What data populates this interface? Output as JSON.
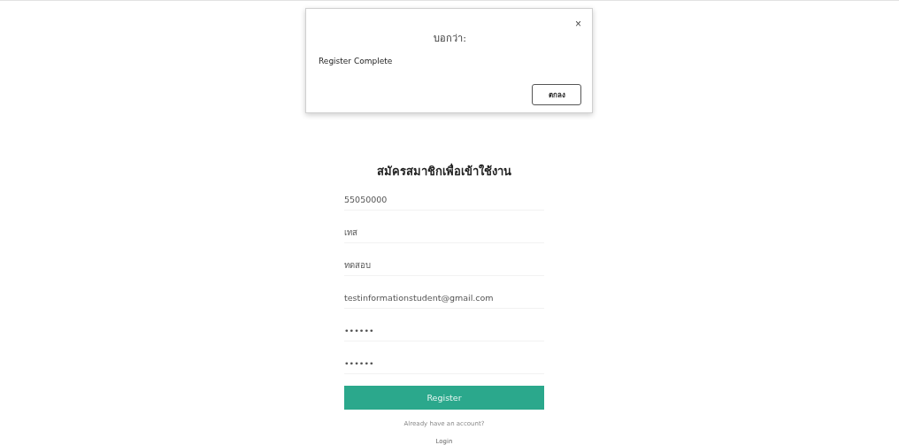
{
  "dialog": {
    "title": "บอกว่า:",
    "close": "×",
    "message": "Register Complete",
    "button": "ตกลง"
  },
  "form": {
    "title": "สมัครสมาชิกเพื่อเข้าใช้งาน",
    "fields": [
      {
        "value": "55050000"
      },
      {
        "value": "เทส"
      },
      {
        "value": "ทดสอบ"
      },
      {
        "value": "testinformationstudent@gmail.com"
      },
      {
        "value": "••••••"
      },
      {
        "value": "••••••"
      }
    ],
    "submit": "Register",
    "hint": "Already have an account?",
    "link": "Login"
  }
}
